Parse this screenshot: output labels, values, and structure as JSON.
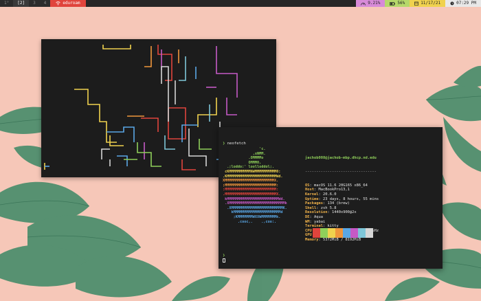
{
  "topbar": {
    "workspaces": [
      {
        "label": "1°",
        "active": false
      },
      {
        "label": "[2]",
        "active": true
      },
      {
        "label": "3",
        "active": false
      },
      {
        "label": "4",
        "active": false
      }
    ],
    "wifi": {
      "icon": "wifi-icon",
      "label": "eduroam"
    },
    "cpu": {
      "icon": "speedometer-icon",
      "label": "9.21%"
    },
    "battery": {
      "icon": "battery-icon",
      "label": "56%"
    },
    "date": {
      "icon": "calendar-icon",
      "label": "11/17/21"
    },
    "time": {
      "icon": "clock-icon",
      "label": "07:29 PM"
    }
  },
  "terminal": {
    "prompt_symbol": "❯",
    "command": "neofetch",
    "ascii_lines": [
      {
        "text": "                 'c.",
        "color": "#8fcf5a"
      },
      {
        "text": "              ,xNMM.",
        "color": "#8fcf5a"
      },
      {
        "text": "            .OMMMMo",
        "color": "#8fcf5a"
      },
      {
        "text": "            OMMM0,",
        "color": "#8fcf5a"
      },
      {
        "text": "  .;loddo:' loolloddol;.",
        "color": "#8fcf5a"
      },
      {
        "text": " cKMMMMMMMMMMNWMMMMMMMMMM0:",
        "color": "#f0d24e"
      },
      {
        "text": ".KMMMMMMMMMMMMMMMMMMMMMMMWd.",
        "color": "#f0d24e"
      },
      {
        "text": "XMMMMMMMMMMMMMMMMMMMMMMMX.",
        "color": "#f0963c"
      },
      {
        "text": ";MMMMMMMMMMMMMMMMMMMMMMMM:",
        "color": "#f0963c"
      },
      {
        "text": ":MMMMMMMMMMMMMMMMMMMMMMMM:",
        "color": "#e0443c"
      },
      {
        "text": ".MMMMMMMMMMMMMMMMMMMMMMMMX.",
        "color": "#e0443c"
      },
      {
        "text": " kMMMMMMMMMMMMMMMMMMMMMMMMWd.",
        "color": "#c55ac6"
      },
      {
        "text": " .XMMMMMMMMMMMMMMMMMMMMMMMMMMk",
        "color": "#c55ac6"
      },
      {
        "text": "  .XMMMMMMMMMMMMMMMMMMMMMMMMK.",
        "color": "#5aa7e6"
      },
      {
        "text": "    kMMMMMMMMMMMMMMMMMMMMMMd",
        "color": "#5aa7e6"
      },
      {
        "text": "     ;KMMMMMMMWXXWMMMMMMMk.",
        "color": "#5aa7e6"
      },
      {
        "text": "       .cooc,.    .,coo:.",
        "color": "#5aa7e6"
      }
    ],
    "user_host": "jachob008@jachob-mbp.dhcp.nd.edu",
    "separator": "--------------------------------",
    "info": [
      {
        "key": "OS",
        "value": "macOS 11.6 20G165 x86_64"
      },
      {
        "key": "Host",
        "value": "MacBookPro13,1"
      },
      {
        "key": "Kernel",
        "value": "20.6.0"
      },
      {
        "key": "Uptime",
        "value": "23 days, 8 hours, 55 mins"
      },
      {
        "key": "Packages",
        "value": "134 (brew)"
      },
      {
        "key": "Shell",
        "value": "zsh 5.8"
      },
      {
        "key": "Resolution",
        "value": "1440x900@2x"
      },
      {
        "key": "DE",
        "value": "Aqua"
      },
      {
        "key": "WM",
        "value": "yabai"
      },
      {
        "key": "Terminal",
        "value": "kitty"
      },
      {
        "key": "CPU",
        "value": "Intel i5-6360U (4) @ 2.00GHz"
      },
      {
        "key": "GPU",
        "value": "Intel Iris Graphics 540"
      },
      {
        "key": "Memory",
        "value": "5372MiB / 8192MiB"
      }
    ],
    "palette": [
      "#e0443c",
      "#8fcf5a",
      "#f0d24e",
      "#f0963c",
      "#5aa7e6",
      "#c55ac6",
      "#7ec6d8",
      "#d6d6d6"
    ]
  },
  "colors": {
    "wallpaper": "#f6c7b8",
    "leaf": "#4f8f6e",
    "bar_bg": "#262626"
  }
}
